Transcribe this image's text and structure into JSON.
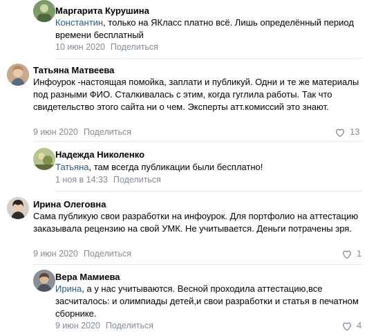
{
  "comments": [
    {
      "name": "Маргарита Курушина",
      "reply_to": "Константин",
      "text": ", только на ЯКласс платно всё. Лишь определённый период времени бесплатный",
      "date": "10 июн 2020",
      "share": "Поделиться",
      "likes": ""
    },
    {
      "name": "Татьяна Матвеева",
      "reply_to": "",
      "text": "Инфоурок -настоящая помойка, заплати и публикуй. Одни и те же материалы под разными ФИО. Сталкивалась с этим, когда гуглила работы. Так что свидетельство этого сайта ни о чем. Эксперты атт.комиссий это знают.",
      "date": "9 июн 2020",
      "share": "Поделиться",
      "likes": "13"
    },
    {
      "name": "Надежда Николенко",
      "reply_to": "Татьяна",
      "text": ", там всегда публикации были бесплатно!",
      "date": "1 ноя в 14:33",
      "share": "Поделиться",
      "likes": ""
    },
    {
      "name": "Ирина Олеговна",
      "reply_to": "",
      "text": "Сама публикую свои разработки на инфоурок. Для портфолио на аттестацию заказывала рецензию на свой УМК. Не учитывается. Деньги потрачены зря.",
      "date": "9 июн 2020",
      "share": "Поделиться",
      "likes": "1"
    },
    {
      "name": "Вера Мамиева",
      "reply_to": "Ирина",
      "text": ", а у нас учитываются. Весной проходила аттестацию,все засчиталось: и олимпиады детей,и свои разработки и статья в печатном сборнике.",
      "date": "9 июн 2020",
      "share": "Поделиться",
      "likes": "4"
    }
  ],
  "colors": {
    "link": "#2a5885",
    "meta": "#818c99",
    "divider": "#e7e8ec"
  },
  "icons": {
    "like": "heart-outline-icon"
  }
}
